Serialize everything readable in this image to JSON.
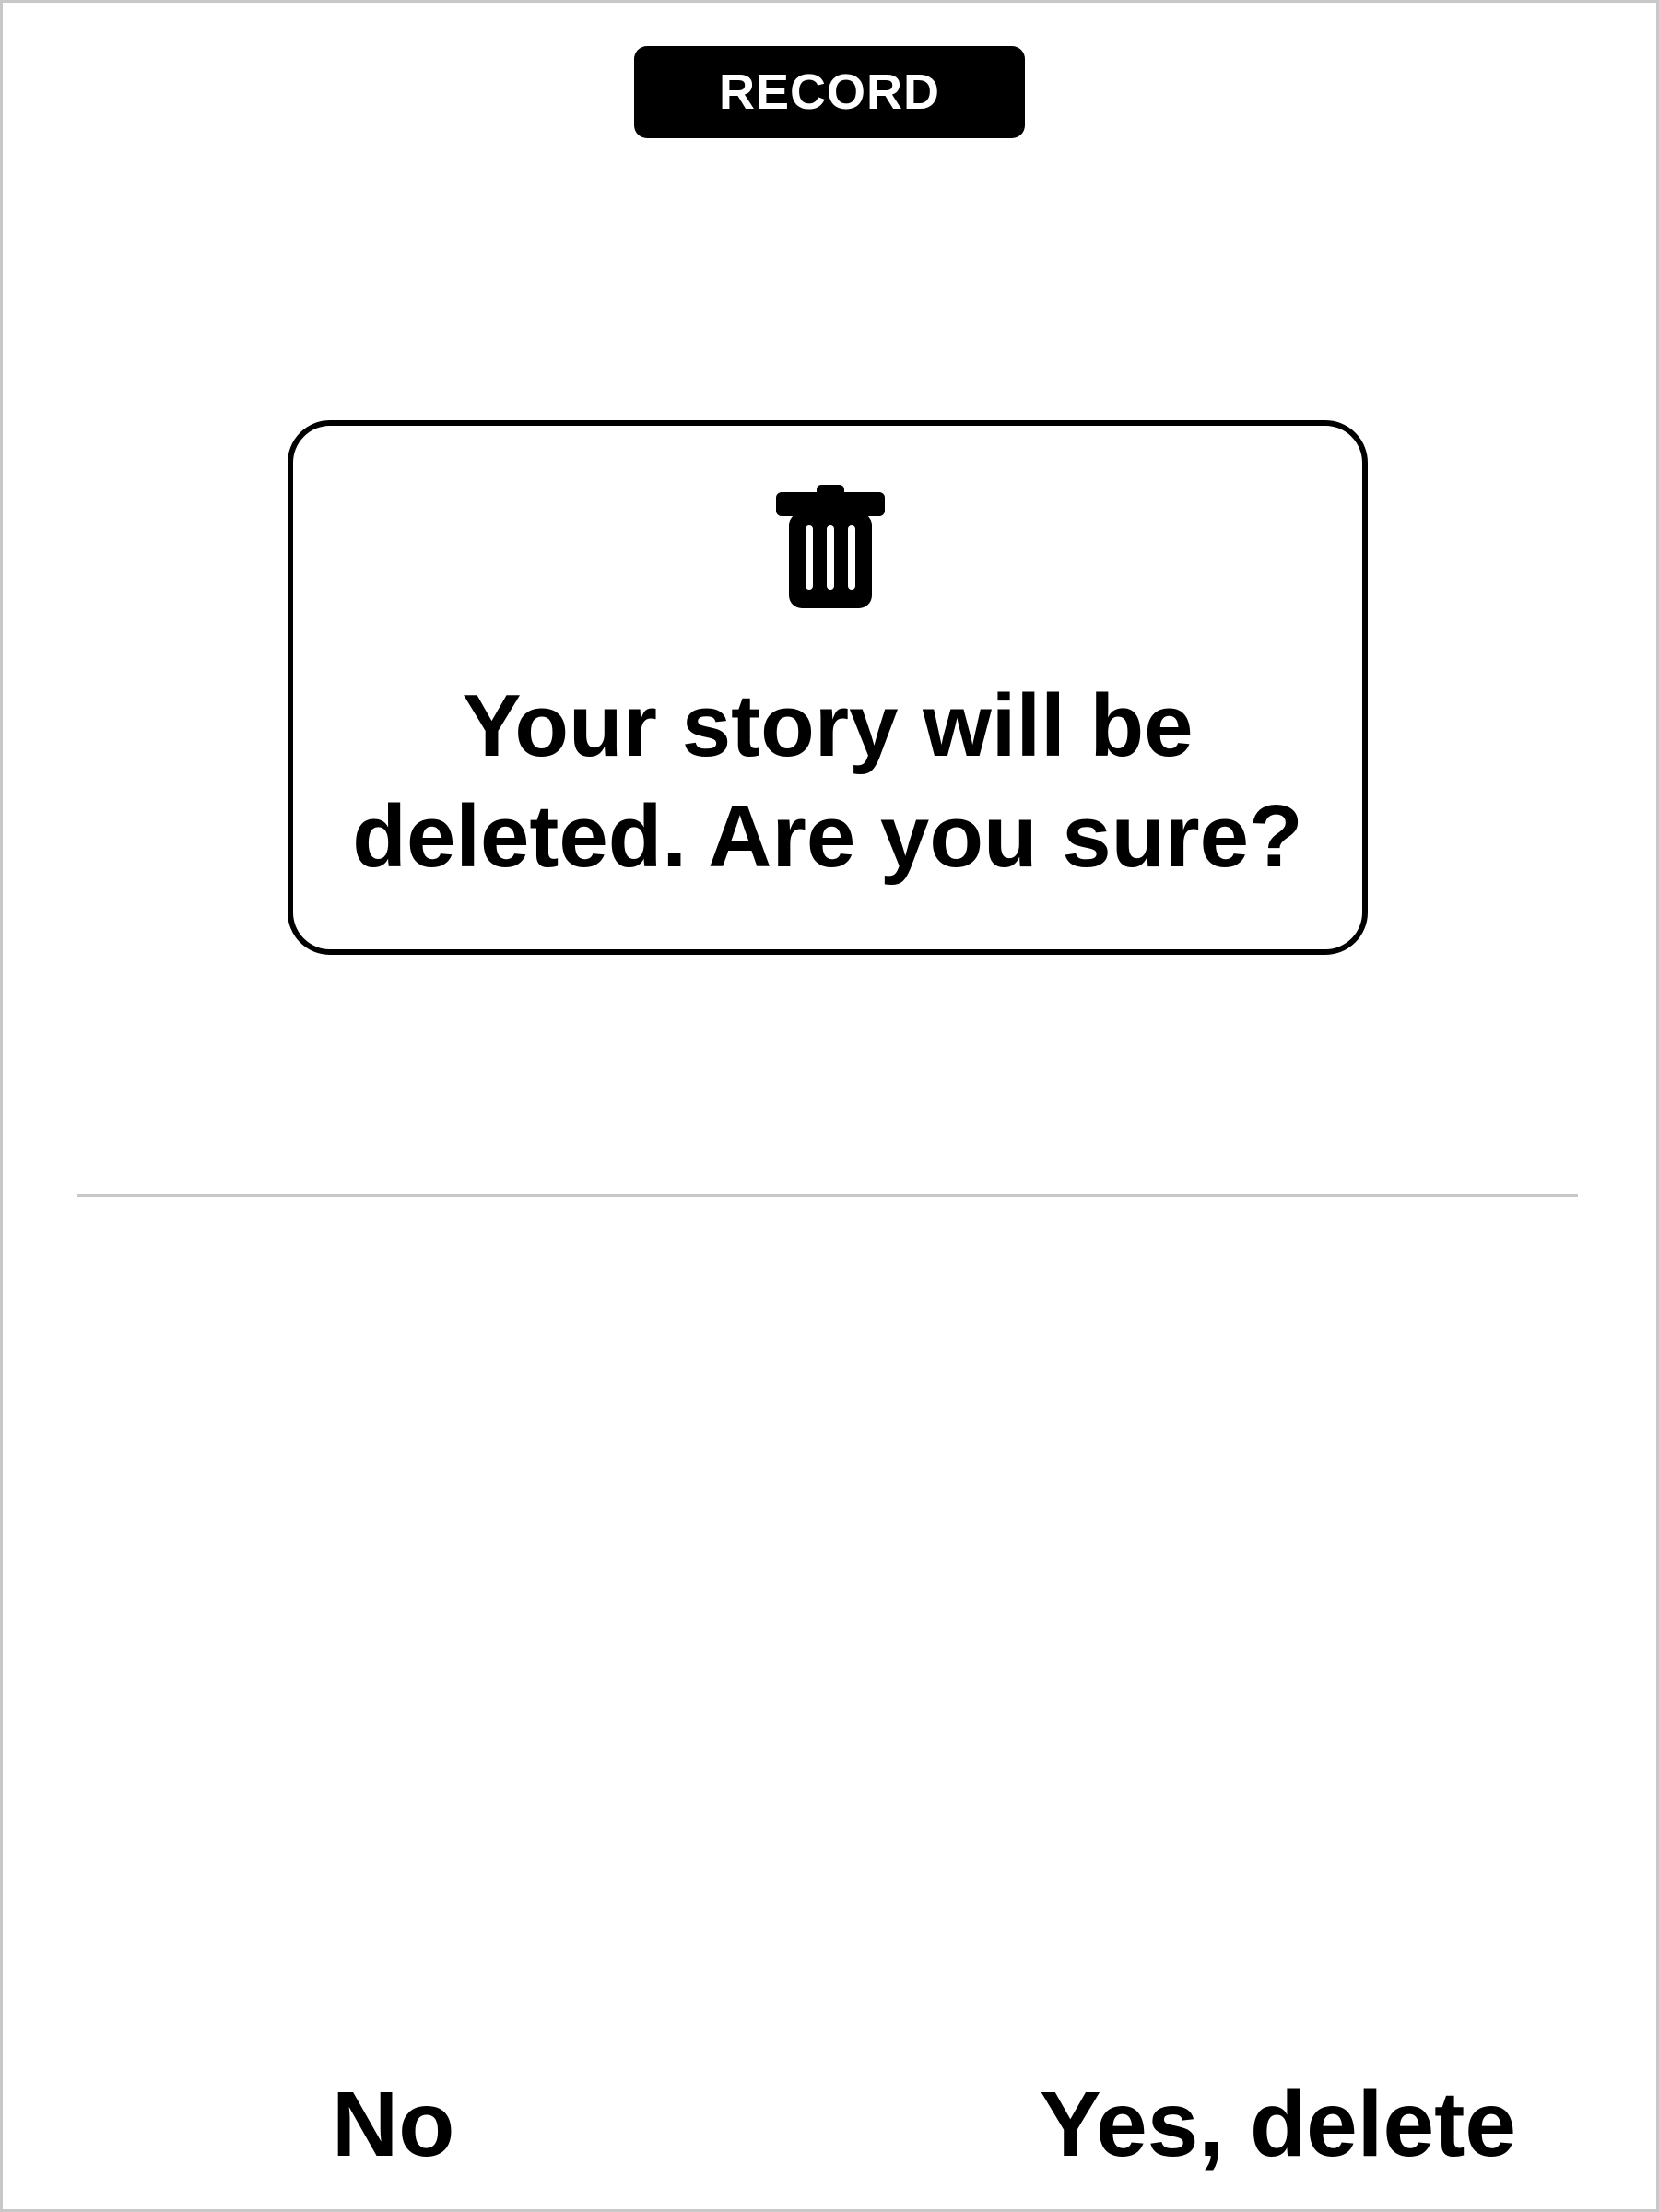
{
  "header": {
    "mode_label": "RECORD"
  },
  "dialog": {
    "icon": "trash-icon",
    "message": "Your story will be\ndeleted. Are you sure?"
  },
  "actions": {
    "cancel_label": "No",
    "confirm_label": "Yes, delete"
  },
  "colors": {
    "foreground": "#000000",
    "background": "#ffffff",
    "divider": "#c8c8c8"
  }
}
